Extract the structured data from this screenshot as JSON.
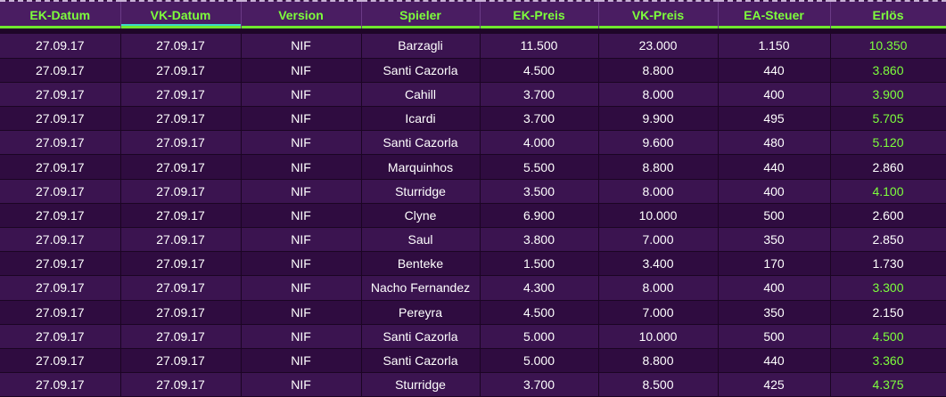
{
  "headers": [
    "EK-Datum",
    "VK-Datum",
    "Version",
    "Spieler",
    "EK-Preis",
    "VK-Preis",
    "EA-Steuer",
    "Erlös"
  ],
  "colors": {
    "header_text": "#7dff3c",
    "profit_green": "#7dff3c",
    "text": "#ffffff",
    "background": "#2a0a36"
  },
  "rows": [
    {
      "ek_datum": "27.09.17",
      "vk_datum": "27.09.17",
      "version": "NIF",
      "spieler": "Barzagli",
      "ek_preis": "11.500",
      "vk_preis": "23.000",
      "ea_steuer": "1.150",
      "erloes": "10.350",
      "highlight": true
    },
    {
      "ek_datum": "27.09.17",
      "vk_datum": "27.09.17",
      "version": "NIF",
      "spieler": "Santi Cazorla",
      "ek_preis": "4.500",
      "vk_preis": "8.800",
      "ea_steuer": "440",
      "erloes": "3.860",
      "highlight": true
    },
    {
      "ek_datum": "27.09.17",
      "vk_datum": "27.09.17",
      "version": "NIF",
      "spieler": "Cahill",
      "ek_preis": "3.700",
      "vk_preis": "8.000",
      "ea_steuer": "400",
      "erloes": "3.900",
      "highlight": true
    },
    {
      "ek_datum": "27.09.17",
      "vk_datum": "27.09.17",
      "version": "NIF",
      "spieler": "Icardi",
      "ek_preis": "3.700",
      "vk_preis": "9.900",
      "ea_steuer": "495",
      "erloes": "5.705",
      "highlight": true
    },
    {
      "ek_datum": "27.09.17",
      "vk_datum": "27.09.17",
      "version": "NIF",
      "spieler": "Santi Cazorla",
      "ek_preis": "4.000",
      "vk_preis": "9.600",
      "ea_steuer": "480",
      "erloes": "5.120",
      "highlight": true
    },
    {
      "ek_datum": "27.09.17",
      "vk_datum": "27.09.17",
      "version": "NIF",
      "spieler": "Marquinhos",
      "ek_preis": "5.500",
      "vk_preis": "8.800",
      "ea_steuer": "440",
      "erloes": "2.860",
      "highlight": false
    },
    {
      "ek_datum": "27.09.17",
      "vk_datum": "27.09.17",
      "version": "NIF",
      "spieler": "Sturridge",
      "ek_preis": "3.500",
      "vk_preis": "8.000",
      "ea_steuer": "400",
      "erloes": "4.100",
      "highlight": true
    },
    {
      "ek_datum": "27.09.17",
      "vk_datum": "27.09.17",
      "version": "NIF",
      "spieler": "Clyne",
      "ek_preis": "6.900",
      "vk_preis": "10.000",
      "ea_steuer": "500",
      "erloes": "2.600",
      "highlight": false
    },
    {
      "ek_datum": "27.09.17",
      "vk_datum": "27.09.17",
      "version": "NIF",
      "spieler": "Saul",
      "ek_preis": "3.800",
      "vk_preis": "7.000",
      "ea_steuer": "350",
      "erloes": "2.850",
      "highlight": false
    },
    {
      "ek_datum": "27.09.17",
      "vk_datum": "27.09.17",
      "version": "NIF",
      "spieler": "Benteke",
      "ek_preis": "1.500",
      "vk_preis": "3.400",
      "ea_steuer": "170",
      "erloes": "1.730",
      "highlight": false
    },
    {
      "ek_datum": "27.09.17",
      "vk_datum": "27.09.17",
      "version": "NIF",
      "spieler": "Nacho Fernandez",
      "ek_preis": "4.300",
      "vk_preis": "8.000",
      "ea_steuer": "400",
      "erloes": "3.300",
      "highlight": true
    },
    {
      "ek_datum": "27.09.17",
      "vk_datum": "27.09.17",
      "version": "NIF",
      "spieler": "Pereyra",
      "ek_preis": "4.500",
      "vk_preis": "7.000",
      "ea_steuer": "350",
      "erloes": "2.150",
      "highlight": false
    },
    {
      "ek_datum": "27.09.17",
      "vk_datum": "27.09.17",
      "version": "NIF",
      "spieler": "Santi Cazorla",
      "ek_preis": "5.000",
      "vk_preis": "10.000",
      "ea_steuer": "500",
      "erloes": "4.500",
      "highlight": true
    },
    {
      "ek_datum": "27.09.17",
      "vk_datum": "27.09.17",
      "version": "NIF",
      "spieler": "Santi Cazorla",
      "ek_preis": "5.000",
      "vk_preis": "8.800",
      "ea_steuer": "440",
      "erloes": "3.360",
      "highlight": true
    },
    {
      "ek_datum": "27.09.17",
      "vk_datum": "27.09.17",
      "version": "NIF",
      "spieler": "Sturridge",
      "ek_preis": "3.700",
      "vk_preis": "8.500",
      "ea_steuer": "425",
      "erloes": "4.375",
      "highlight": true
    }
  ]
}
